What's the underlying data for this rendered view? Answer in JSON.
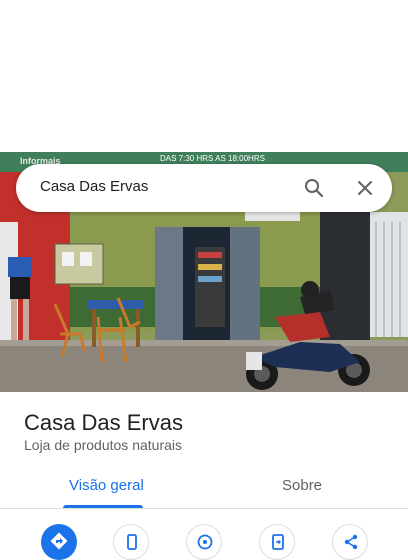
{
  "search": {
    "query": "Casa Das Ervas"
  },
  "photo": {
    "sign_text": "DAS 7:30 HRS AS 18:00HRS",
    "sign_brand": "Informais"
  },
  "place": {
    "name": "Casa Das Ervas",
    "category": "Loja de produtos naturais"
  },
  "tabs": [
    {
      "label": "Visão geral",
      "active": true
    },
    {
      "label": "Sobre",
      "active": false
    }
  ],
  "actions": [
    {
      "icon": "directions-icon",
      "primary": true
    },
    {
      "icon": "phone-icon",
      "primary": false
    },
    {
      "icon": "nearby-icon",
      "primary": false
    },
    {
      "icon": "send-to-phone-icon",
      "primary": false
    },
    {
      "icon": "share-icon",
      "primary": false
    }
  ],
  "colors": {
    "accent": "#1a73e8",
    "text_primary": "#202124",
    "text_secondary": "#5f6368"
  }
}
